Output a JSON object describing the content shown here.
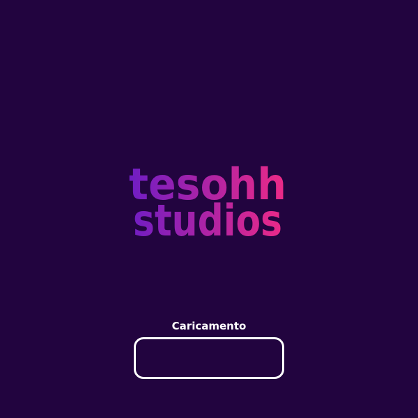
{
  "background_color": "#22043f",
  "logo": {
    "line1": "tesohh",
    "line2": "studios",
    "gradient_start": "#6f1dc4",
    "gradient_end": "#ee2a86"
  },
  "loading": {
    "label": "Caricamento",
    "progress": 0,
    "border_color": "#ffffff"
  }
}
